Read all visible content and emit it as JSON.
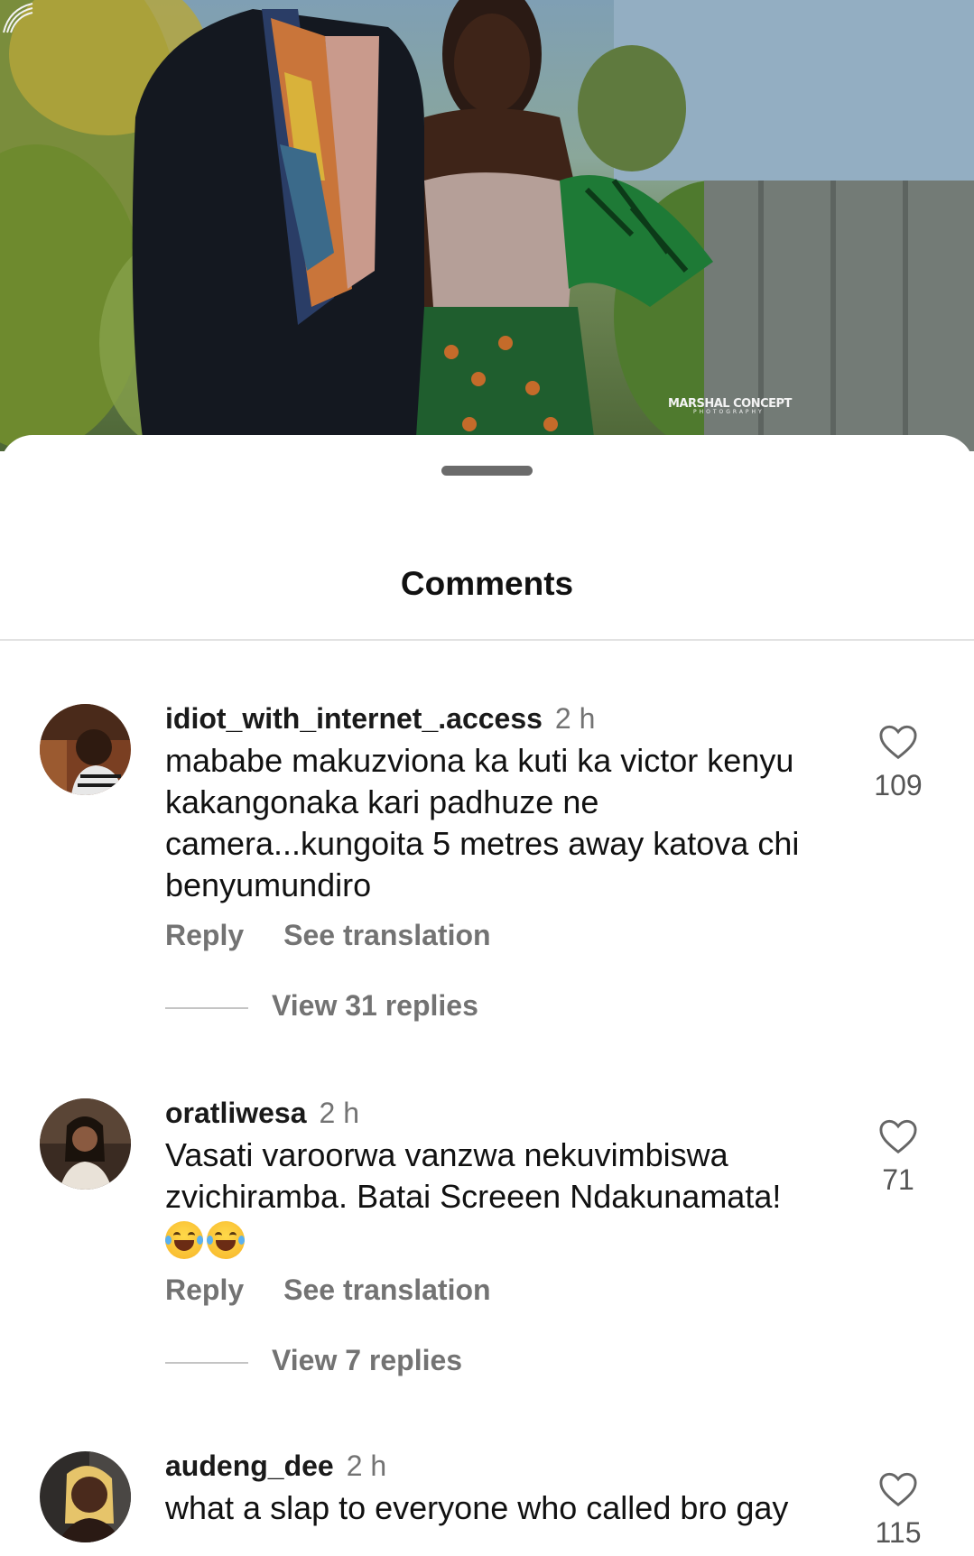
{
  "photo": {
    "watermark": "MARSHAL CONCEPT",
    "watermark_sub": "PHOTOGRAPHY"
  },
  "sheet": {
    "title": "Comments"
  },
  "comments": [
    {
      "username": "idiot_with_internet_.access",
      "time": "2 h",
      "text": "mababe makuzviona ka kuti ka victor kenyu kakangonaka kari padhuze ne camera...kungoita 5 metres away katova chi benyumundiro",
      "reply_label": "Reply",
      "translate_label": "See translation",
      "view_replies": "View 31 replies",
      "likes": "109"
    },
    {
      "username": "oratliwesa",
      "time": "2 h",
      "text": "Vasati varoorwa vanzwa nekuvimbiswa zvichiramba. Batai Screeen Ndakunamata!",
      "emoji": "😂😂",
      "reply_label": "Reply",
      "translate_label": "See translation",
      "view_replies": "View 7 replies",
      "likes": "71"
    },
    {
      "username": "audeng_dee",
      "time": "2 h",
      "text": "what a slap to everyone who called bro gay",
      "likes": "115"
    }
  ],
  "colors": {
    "text_primary": "#111111",
    "text_secondary": "#737373",
    "divider": "#e2e2e2",
    "sheet_bg": "#ffffff"
  },
  "icons": {
    "like": "heart-outline-icon",
    "drag": "drag-handle",
    "emoji": "face-with-tears-of-joy"
  }
}
